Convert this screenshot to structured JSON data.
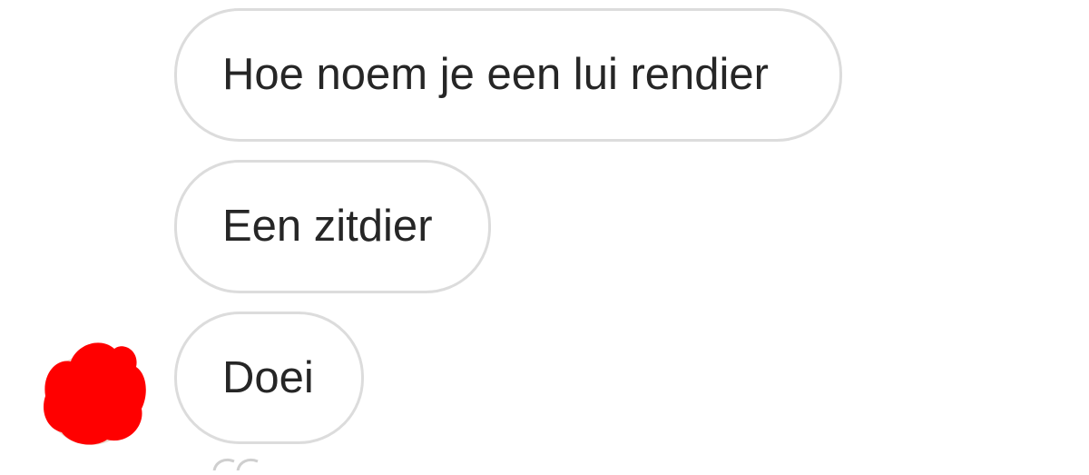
{
  "messages": [
    {
      "text": "Hoe noem je een lui rendier"
    },
    {
      "text": "Een zitdier"
    },
    {
      "text": "Doei"
    }
  ],
  "colors": {
    "bubble_border": "#dcdcdc",
    "bubble_text": "#262626",
    "background": "#ffffff",
    "avatar_redaction": "#ff0000"
  },
  "icons": {
    "avatar": "redacted-avatar",
    "reaction": "reaction-icon"
  }
}
